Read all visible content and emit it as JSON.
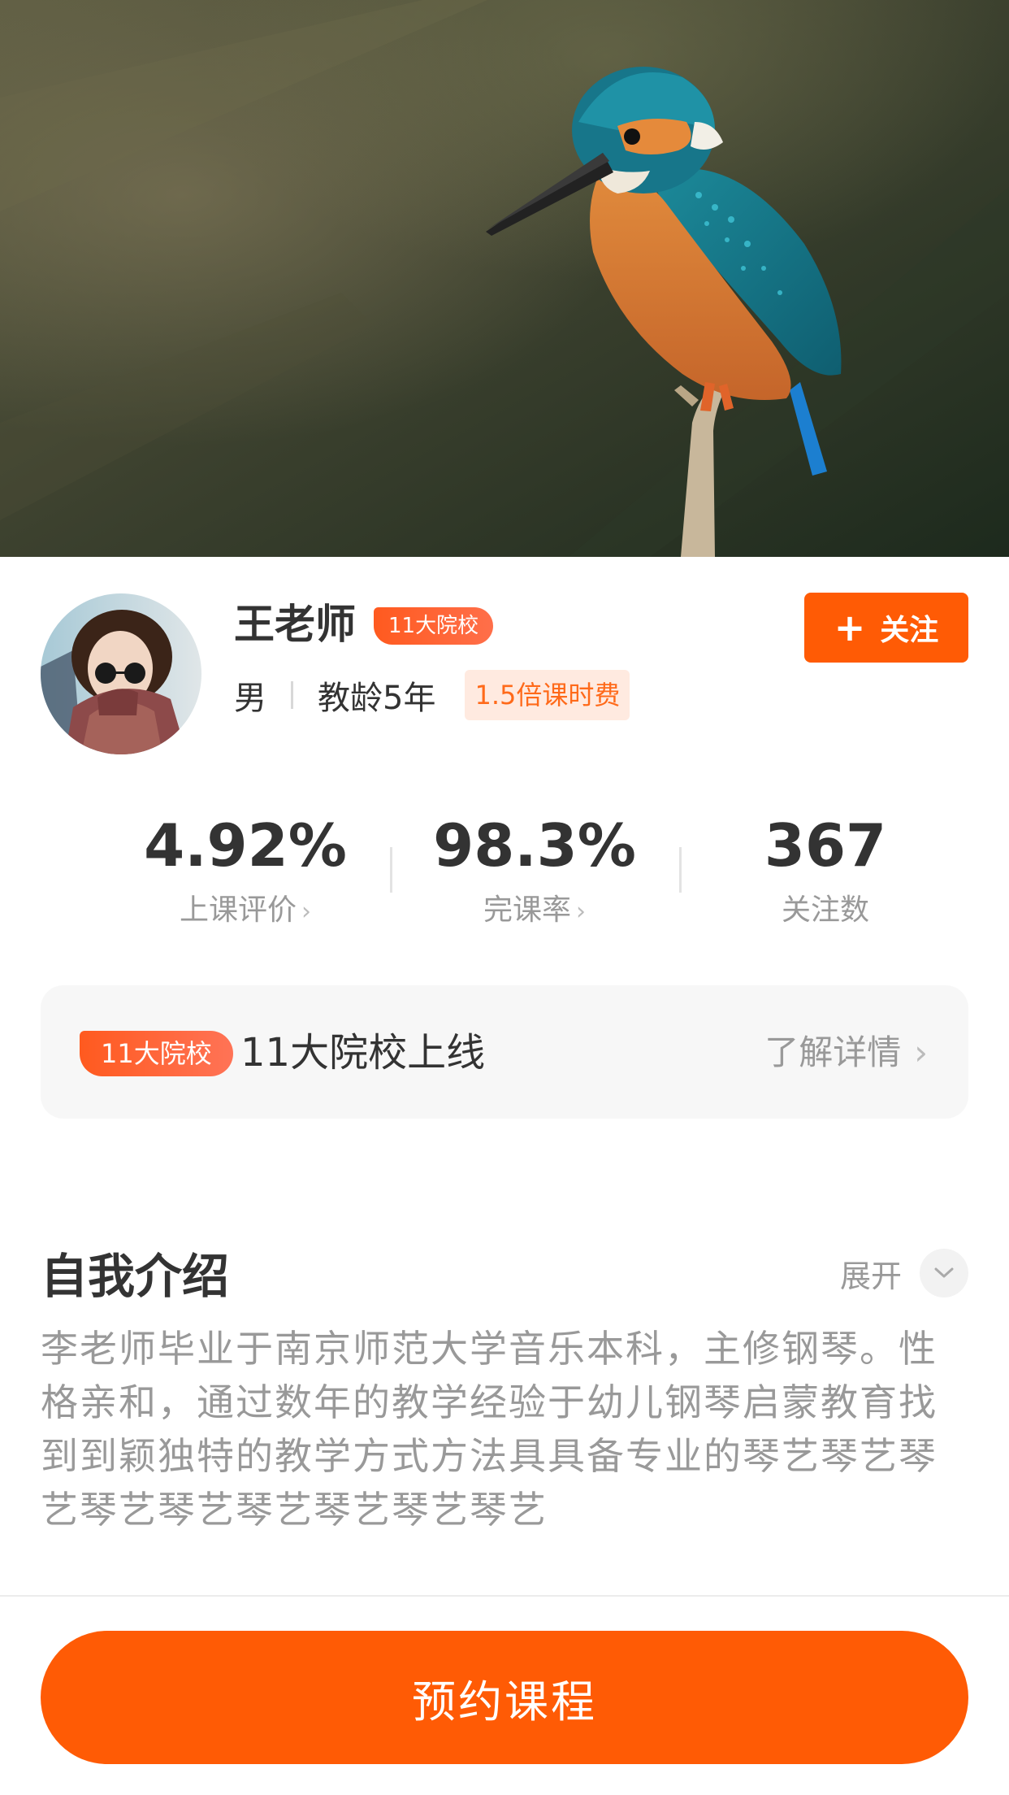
{
  "teacher": {
    "name": "王老师",
    "badge": "11大院校",
    "gender": "男",
    "experience": "教龄5年",
    "rate_tag": "1.5倍课时费",
    "follow_label": "关注"
  },
  "stats": [
    {
      "value": "4.92%",
      "label": "上课评价",
      "chevron": "›"
    },
    {
      "value": "98.3%",
      "label": "完课率",
      "chevron": "›"
    },
    {
      "value": "367",
      "label": "关注数",
      "chevron": ""
    }
  ],
  "banner": {
    "badge": "11大院校",
    "title": "11大院校上线",
    "link": "了解详情",
    "chevron": "›"
  },
  "intro": {
    "title": "自我介绍",
    "expand": "展开",
    "text": "李老师毕业于南京师范大学音乐本科，主修钢琴。性格亲和，通过数年的教学经验于幼儿钢琴启蒙教育找到到颖独特的教学方式方法具具备专业的琴艺琴艺琴艺琴艺琴艺琴艺琴艺琴艺琴艺"
  },
  "cta": {
    "label": "预约课程"
  },
  "icons": {
    "follow": "plus-icon",
    "expand": "chevron-down-icon",
    "stat_link": "chevron-right-icon"
  },
  "colors": {
    "accent": "#ff5b05",
    "badge": "#ff5a1f",
    "tag_bg": "#ffeae0",
    "muted_text": "#999999"
  }
}
